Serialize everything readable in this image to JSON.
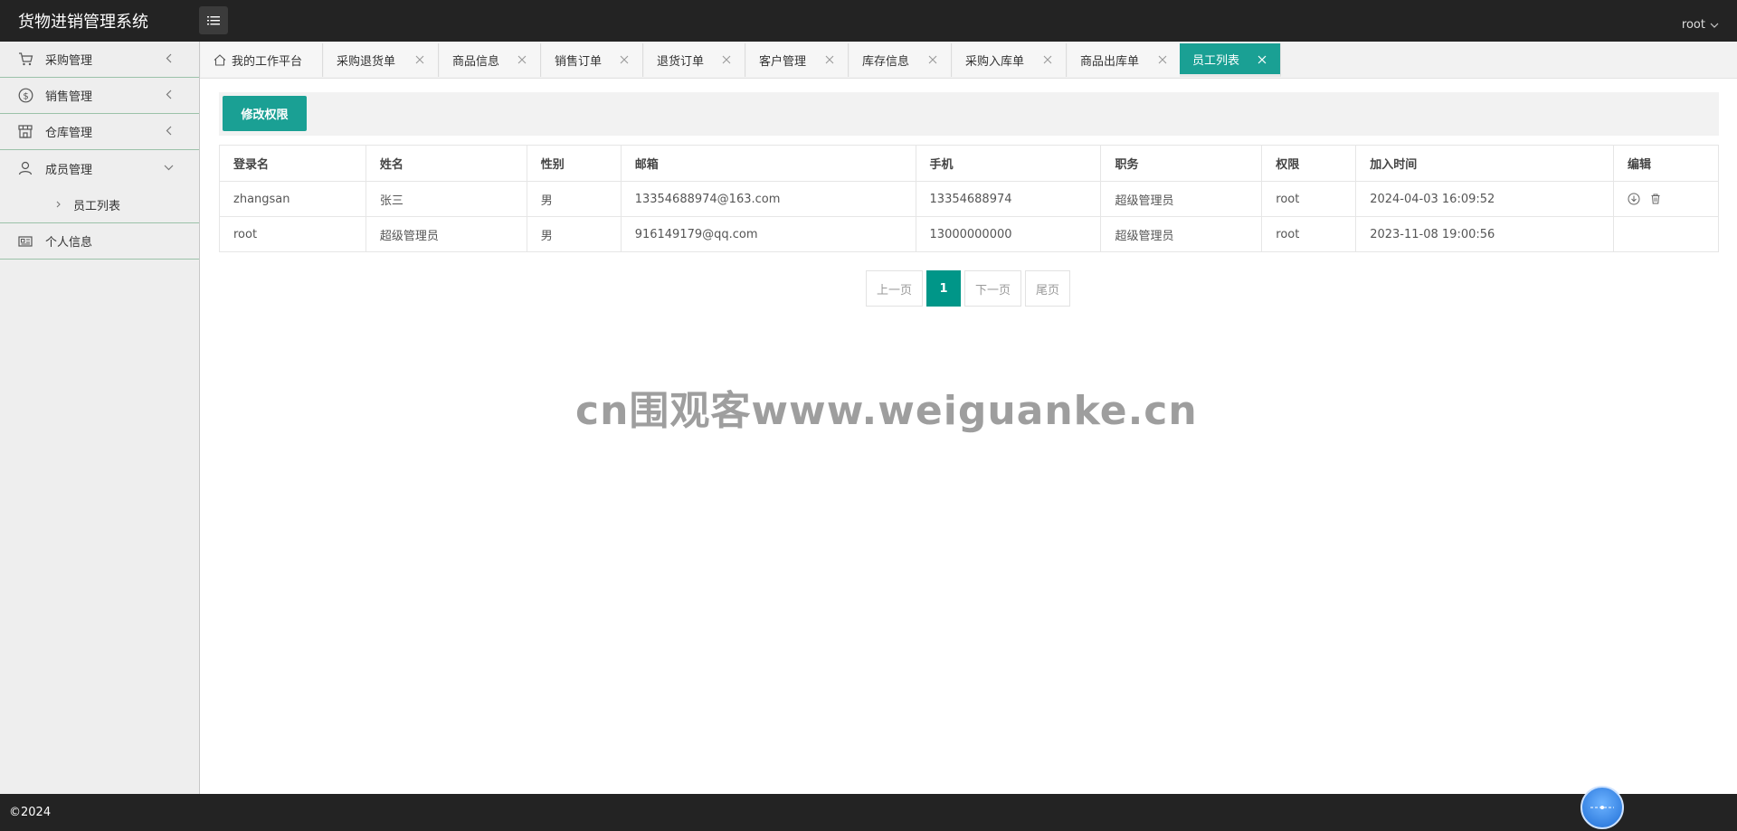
{
  "header": {
    "app_title": "货物进销管理系统",
    "user_name": "root"
  },
  "sidebar": {
    "items": [
      {
        "label": "采购管理",
        "icon": "cart-icon"
      },
      {
        "label": "销售管理",
        "icon": "dollar-icon"
      },
      {
        "label": "仓库管理",
        "icon": "store-icon"
      },
      {
        "label": "成员管理",
        "icon": "user-icon"
      },
      {
        "label": "员工列表"
      },
      {
        "label": "个人信息",
        "icon": "id-card-icon"
      }
    ]
  },
  "tabs": [
    {
      "label": "我的工作平台"
    },
    {
      "label": "采购退货单"
    },
    {
      "label": "商品信息"
    },
    {
      "label": "销售订单"
    },
    {
      "label": "退货订单"
    },
    {
      "label": "客户管理"
    },
    {
      "label": "库存信息"
    },
    {
      "label": "采购入库单"
    },
    {
      "label": "商品出库单"
    },
    {
      "label": "员工列表",
      "active": true
    }
  ],
  "toolbar": {
    "modify_permission": "修改权限"
  },
  "table": {
    "headers": [
      "登录名",
      "姓名",
      "性别",
      "邮箱",
      "手机",
      "职务",
      "权限",
      "加入时间",
      "编辑"
    ],
    "rows": [
      [
        "zhangsan",
        "张三",
        "男",
        "13354688974@163.com",
        "13354688974",
        "超级管理员",
        "root",
        "2024-04-03 16:09:52"
      ],
      [
        "root",
        "超级管理员",
        "男",
        "916149179@qq.com",
        "13000000000",
        "超级管理员",
        "root",
        "2023-11-08 19:00:56"
      ]
    ]
  },
  "pagination": {
    "prev": "上一页",
    "current": "1",
    "next": "下一页",
    "last": "尾页"
  },
  "watermark": "cn围观客www.weiguanke.cn",
  "footer": {
    "copyright": "©2024"
  },
  "colors": {
    "accent": "#1aa094",
    "header_bg": "#232323",
    "sidebar_bg": "#eeeeee"
  }
}
